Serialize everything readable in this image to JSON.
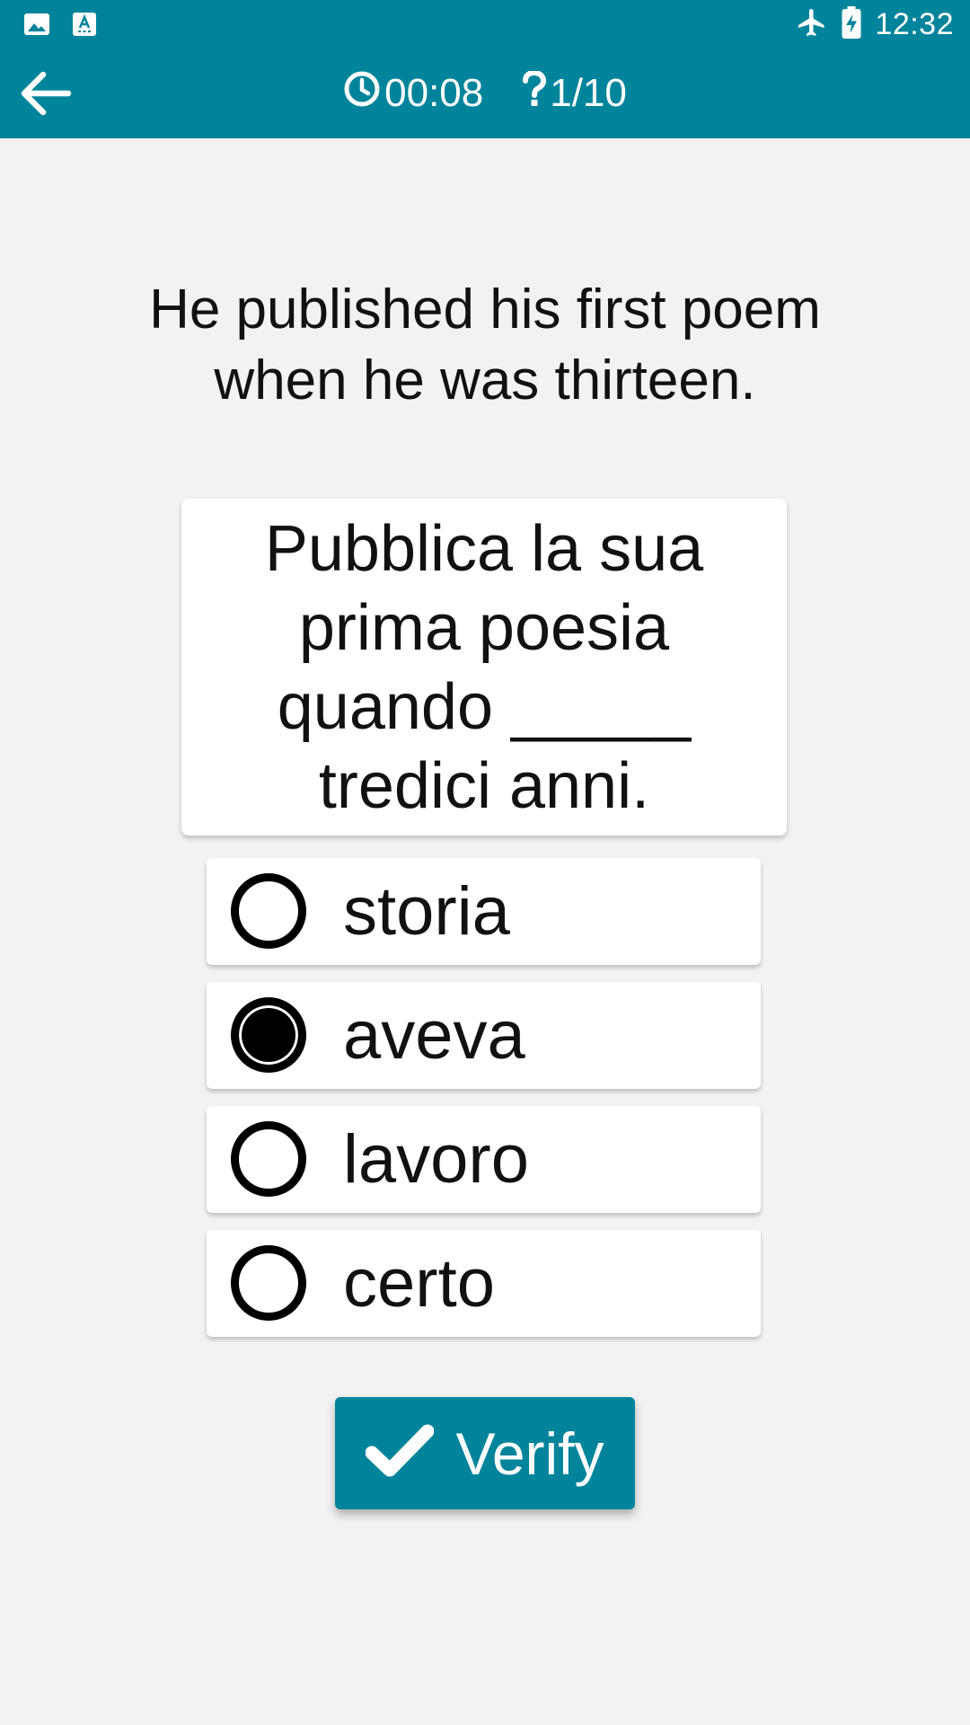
{
  "status_bar": {
    "time": "12:32",
    "left_icons": [
      "image-icon",
      "keyboard-icon"
    ],
    "right_icons": [
      "airplane-icon",
      "battery-charging-icon"
    ]
  },
  "toolbar": {
    "back_icon": "arrow-left-icon",
    "timer_icon": "clock-icon",
    "timer": "00:08",
    "progress_icon": "question-icon",
    "progress": "1/10"
  },
  "quiz": {
    "prompt": "He published his first poem when he was thirteen.",
    "sentence": "Pubblica la sua prima poesia quando _____ tredici anni.",
    "options": [
      {
        "label": "storia",
        "selected": false
      },
      {
        "label": "aveva",
        "selected": true
      },
      {
        "label": "lavoro",
        "selected": false
      },
      {
        "label": "certo",
        "selected": false
      }
    ],
    "verify_label": "Verify",
    "verify_icon": "check-icon"
  },
  "colors": {
    "primary": "#00849b",
    "background": "#f2f2f2",
    "card": "#ffffff",
    "text": "#111111"
  }
}
